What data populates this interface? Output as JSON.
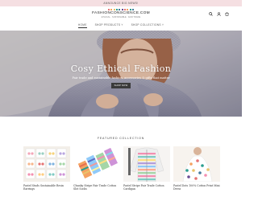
{
  "announcement": "ANNOUNCE BIG NEWS!",
  "header": {
    "logo_text": "FASHIONCONSCIENCE.COM",
    "logo_subtext": "ETHICAL · SUSTAINABLE · FAIR TRADE",
    "logo_dot_colors": [
      "#e57373",
      "#f4a261",
      "#e9c46a",
      "#2a9d8f",
      "#457b9d",
      "#6a4c93",
      "#e57373",
      "#f4a261",
      "#2a9d8f",
      "#457b9d"
    ],
    "icons": [
      "search-icon",
      "user-icon",
      "cart-icon"
    ]
  },
  "nav": {
    "items": [
      {
        "label": "HOME"
      },
      {
        "label": "SHOP PRODUCTS ˅"
      },
      {
        "label": "SHOP COLLECTIONS ˅"
      }
    ]
  },
  "hero": {
    "title": "Cosy Ethical Fashion",
    "subtitle": "Fair trade and sustainable fashion, accessories & gifts that matter",
    "button_label": "SHOP NOW"
  },
  "collection": {
    "title": "FEATURED COLLECTION",
    "products": [
      {
        "name": "Pastel Studs Sustainable Resin Earrings"
      },
      {
        "name": "Chunky Stripe Fair Trade Cotton Slot Socks"
      },
      {
        "name": "Pastel Stripe Fair Trade Cotton Cardigan"
      },
      {
        "name": "Pastel Dots 100% Cotton Print Mini Dress"
      }
    ]
  }
}
